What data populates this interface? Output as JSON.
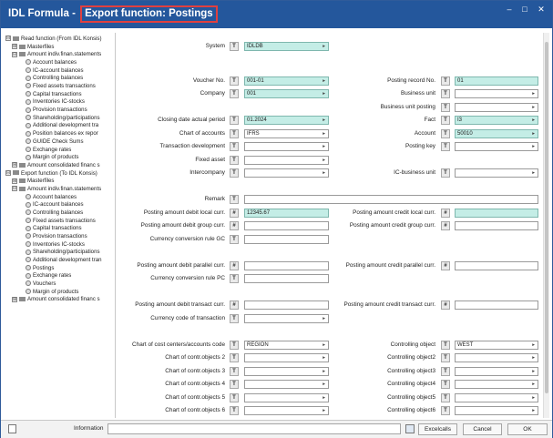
{
  "window": {
    "title_prefix": "IDL Formula - ",
    "title_highlight": "Export function: Postings",
    "minimize": "–",
    "maximize": "□",
    "close": "✕"
  },
  "tree": [
    {
      "id": "rf",
      "label": "Read function (From IDL Konsis)",
      "kind": "folder",
      "exp": "⊟"
    },
    {
      "id": "rf-m",
      "label": "Masterfiles",
      "kind": "folder",
      "exp": "⊞"
    },
    {
      "id": "rf-a",
      "label": "Amount indiv.finan.statements",
      "kind": "folder",
      "exp": "⊟"
    },
    {
      "id": "rf-a1",
      "label": "Account balances",
      "kind": "item"
    },
    {
      "id": "rf-a2",
      "label": "IC-account balances",
      "kind": "item"
    },
    {
      "id": "rf-a3",
      "label": "Controlling balances",
      "kind": "item"
    },
    {
      "id": "rf-a4",
      "label": "Fixed assets transactions",
      "kind": "item"
    },
    {
      "id": "rf-a5",
      "label": "Capital transactions",
      "kind": "item"
    },
    {
      "id": "rf-a6",
      "label": "Inventories IC-stocks",
      "kind": "item"
    },
    {
      "id": "rf-a7",
      "label": "Provision transactions",
      "kind": "item"
    },
    {
      "id": "rf-a8",
      "label": "Shareholding/participations",
      "kind": "item"
    },
    {
      "id": "rf-a9",
      "label": "Additional development tra",
      "kind": "item"
    },
    {
      "id": "rf-a10",
      "label": "Position balances ex repor",
      "kind": "item"
    },
    {
      "id": "rf-a11",
      "label": "GUIDE Check Sums",
      "kind": "item"
    },
    {
      "id": "rf-a12",
      "label": "Exchange rates",
      "kind": "item"
    },
    {
      "id": "rf-a13",
      "label": "Margin of products",
      "kind": "item"
    },
    {
      "id": "rf-c",
      "label": "Amount consolidated financ s",
      "kind": "folder",
      "exp": "⊞"
    },
    {
      "id": "ef",
      "label": "Export function (To IDL Konsis)",
      "kind": "folder",
      "exp": "⊟"
    },
    {
      "id": "ef-m",
      "label": "Masterfiles",
      "kind": "folder",
      "exp": "⊞"
    },
    {
      "id": "ef-a",
      "label": "Amount indiv.finan.statements",
      "kind": "folder",
      "exp": "⊟"
    },
    {
      "id": "ef-a1",
      "label": "Account balances",
      "kind": "item"
    },
    {
      "id": "ef-a2",
      "label": "IC-account balances",
      "kind": "item"
    },
    {
      "id": "ef-a3",
      "label": "Controlling balances",
      "kind": "item"
    },
    {
      "id": "ef-a4",
      "label": "Fixed assets transactions",
      "kind": "item"
    },
    {
      "id": "ef-a5",
      "label": "Capital transactions",
      "kind": "item"
    },
    {
      "id": "ef-a6",
      "label": "Provision transactions",
      "kind": "item"
    },
    {
      "id": "ef-a7",
      "label": "Inventories IC-stocks",
      "kind": "item"
    },
    {
      "id": "ef-a8",
      "label": "Shareholding/participations",
      "kind": "item"
    },
    {
      "id": "ef-a9",
      "label": "Additional development tran",
      "kind": "item"
    },
    {
      "id": "ef-a10",
      "label": "Postings",
      "kind": "item"
    },
    {
      "id": "ef-a11",
      "label": "Exchange rates",
      "kind": "item"
    },
    {
      "id": "ef-a12",
      "label": "Vouchers",
      "kind": "item"
    },
    {
      "id": "ef-a13",
      "label": "Margin of products",
      "kind": "item"
    },
    {
      "id": "ef-c",
      "label": "Amount consolidated financ s",
      "kind": "folder",
      "exp": "⊞"
    }
  ],
  "form": {
    "t_label": "T",
    "hash_label": "#",
    "dropdown_arrow": "▸",
    "fields": [
      {
        "id": "system",
        "label": "System",
        "value": "IDLDB",
        "btn": "T",
        "teal": true,
        "dd": true
      },
      {
        "id": "voucher-no",
        "label": "Voucher No.",
        "value": "001-01",
        "btn": "T",
        "teal": true,
        "dd": true
      },
      {
        "id": "posting-record-no",
        "label": "Posting record No.",
        "value": "01",
        "btn": "T",
        "teal": true,
        "dd": false
      },
      {
        "id": "company",
        "label": "Company",
        "value": "001",
        "btn": "T",
        "teal": true,
        "dd": true
      },
      {
        "id": "business-unit",
        "label": "Business unit",
        "value": "",
        "btn": "T",
        "teal": false,
        "dd": true
      },
      {
        "id": "business-unit-posting",
        "label": "Business unit posting",
        "value": "",
        "btn": "T",
        "teal": false,
        "dd": true
      },
      {
        "id": "closing-date",
        "label": "Closing date actual period",
        "value": "01.2024",
        "btn": "T",
        "teal": true,
        "dd": true
      },
      {
        "id": "fact",
        "label": "Fact",
        "value": "I3",
        "btn": "T",
        "teal": true,
        "dd": true
      },
      {
        "id": "chart-of-accounts",
        "label": "Chart of accounts",
        "value": "IFRS",
        "btn": "T",
        "teal": false,
        "dd": true
      },
      {
        "id": "account",
        "label": "Account",
        "value": "50010",
        "btn": "T",
        "teal": true,
        "dd": true
      },
      {
        "id": "transaction-development",
        "label": "Transaction development",
        "value": "",
        "btn": "T",
        "teal": false,
        "dd": true
      },
      {
        "id": "posting-key",
        "label": "Posting key",
        "value": "",
        "btn": "T",
        "teal": false,
        "dd": true
      },
      {
        "id": "fixed-asset",
        "label": "Fixed asset",
        "value": "",
        "btn": "T",
        "teal": false,
        "dd": true
      },
      {
        "id": "intercompany",
        "label": "Intercompany",
        "value": "",
        "btn": "T",
        "teal": false,
        "dd": true
      },
      {
        "id": "ic-business-unit",
        "label": "IC-business unit",
        "value": "",
        "btn": "T",
        "teal": false,
        "dd": true
      },
      {
        "id": "remark",
        "label": "Remark",
        "value": "",
        "btn": "T",
        "teal": false,
        "dd": false
      },
      {
        "id": "posting-amount-debit-local",
        "label": "Posting amount debit local curr.",
        "value": "12345.67",
        "btn": "#",
        "teal": true,
        "dd": false
      },
      {
        "id": "posting-amount-credit-local",
        "label": "Posting amount credit local curr.",
        "value": "",
        "btn": "#",
        "teal": true,
        "dd": false
      },
      {
        "id": "posting-amount-debit-group",
        "label": "Posting amount debit group curr.",
        "value": "",
        "btn": "#",
        "teal": false,
        "dd": false
      },
      {
        "id": "posting-amount-credit-group",
        "label": "Posting amount credit group curr.",
        "value": "",
        "btn": "#",
        "teal": false,
        "dd": false
      },
      {
        "id": "currency-conversion-gc",
        "label": "Currency conversion rule GC",
        "value": "",
        "btn": "T",
        "teal": false,
        "dd": false
      },
      {
        "id": "posting-amount-debit-parallel",
        "label": "Posting amount debit parallel curr.",
        "value": "",
        "btn": "#",
        "teal": false,
        "dd": false
      },
      {
        "id": "posting-amount-credit-parallel",
        "label": "Posting amount credit parallel curr.",
        "value": "",
        "btn": "#",
        "teal": false,
        "dd": false
      },
      {
        "id": "currency-conversion-pc",
        "label": "Currency conversion rule PC",
        "value": "",
        "btn": "T",
        "teal": false,
        "dd": false
      },
      {
        "id": "posting-amount-debit-transact",
        "label": "Posting amount debit transact curr.",
        "value": "",
        "btn": "#",
        "teal": false,
        "dd": false
      },
      {
        "id": "posting-amount-credit-transact",
        "label": "Posting amount credit transact curr.",
        "value": "",
        "btn": "#",
        "teal": false,
        "dd": false
      },
      {
        "id": "currency-code-transaction",
        "label": "Currency code of transaction",
        "value": "",
        "btn": "T",
        "teal": false,
        "dd": true
      },
      {
        "id": "chart-cost-centers",
        "label": "Chart of cost centers/accounts code",
        "value": "REGION",
        "btn": "T",
        "teal": false,
        "dd": true
      },
      {
        "id": "controlling-object",
        "label": "Controlling object",
        "value": "WEST",
        "btn": "T",
        "teal": false,
        "dd": true
      },
      {
        "id": "chart-contr-objects-2",
        "label": "Chart of contr.objects 2",
        "value": "",
        "btn": "T",
        "teal": false,
        "dd": true
      },
      {
        "id": "controlling-object2",
        "label": "Controlling object2",
        "value": "",
        "btn": "T",
        "teal": false,
        "dd": true
      },
      {
        "id": "chart-contr-objects-3",
        "label": "Chart of contr.objects 3",
        "value": "",
        "btn": "T",
        "teal": false,
        "dd": true
      },
      {
        "id": "controlling-object3",
        "label": "Controlling object3",
        "value": "",
        "btn": "T",
        "teal": false,
        "dd": true
      },
      {
        "id": "chart-contr-objects-4",
        "label": "Chart of contr.objects 4",
        "value": "",
        "btn": "T",
        "teal": false,
        "dd": true
      },
      {
        "id": "controlling-object4",
        "label": "Controlling object4",
        "value": "",
        "btn": "T",
        "teal": false,
        "dd": true
      },
      {
        "id": "chart-contr-objects-5",
        "label": "Chart of contr.objects 5",
        "value": "",
        "btn": "T",
        "teal": false,
        "dd": true
      },
      {
        "id": "controlling-object5",
        "label": "Controlling object5",
        "value": "",
        "btn": "T",
        "teal": false,
        "dd": true
      },
      {
        "id": "chart-contr-objects-6",
        "label": "Chart of contr.objects 6",
        "value": "",
        "btn": "T",
        "teal": false,
        "dd": true
      },
      {
        "id": "controlling-object6",
        "label": "Controlling object6",
        "value": "",
        "btn": "T",
        "teal": false,
        "dd": true
      }
    ]
  },
  "bottom": {
    "information_label": "Information",
    "excelcalls": "Excelcalls",
    "cancel": "Cancel",
    "ok": "OK"
  }
}
